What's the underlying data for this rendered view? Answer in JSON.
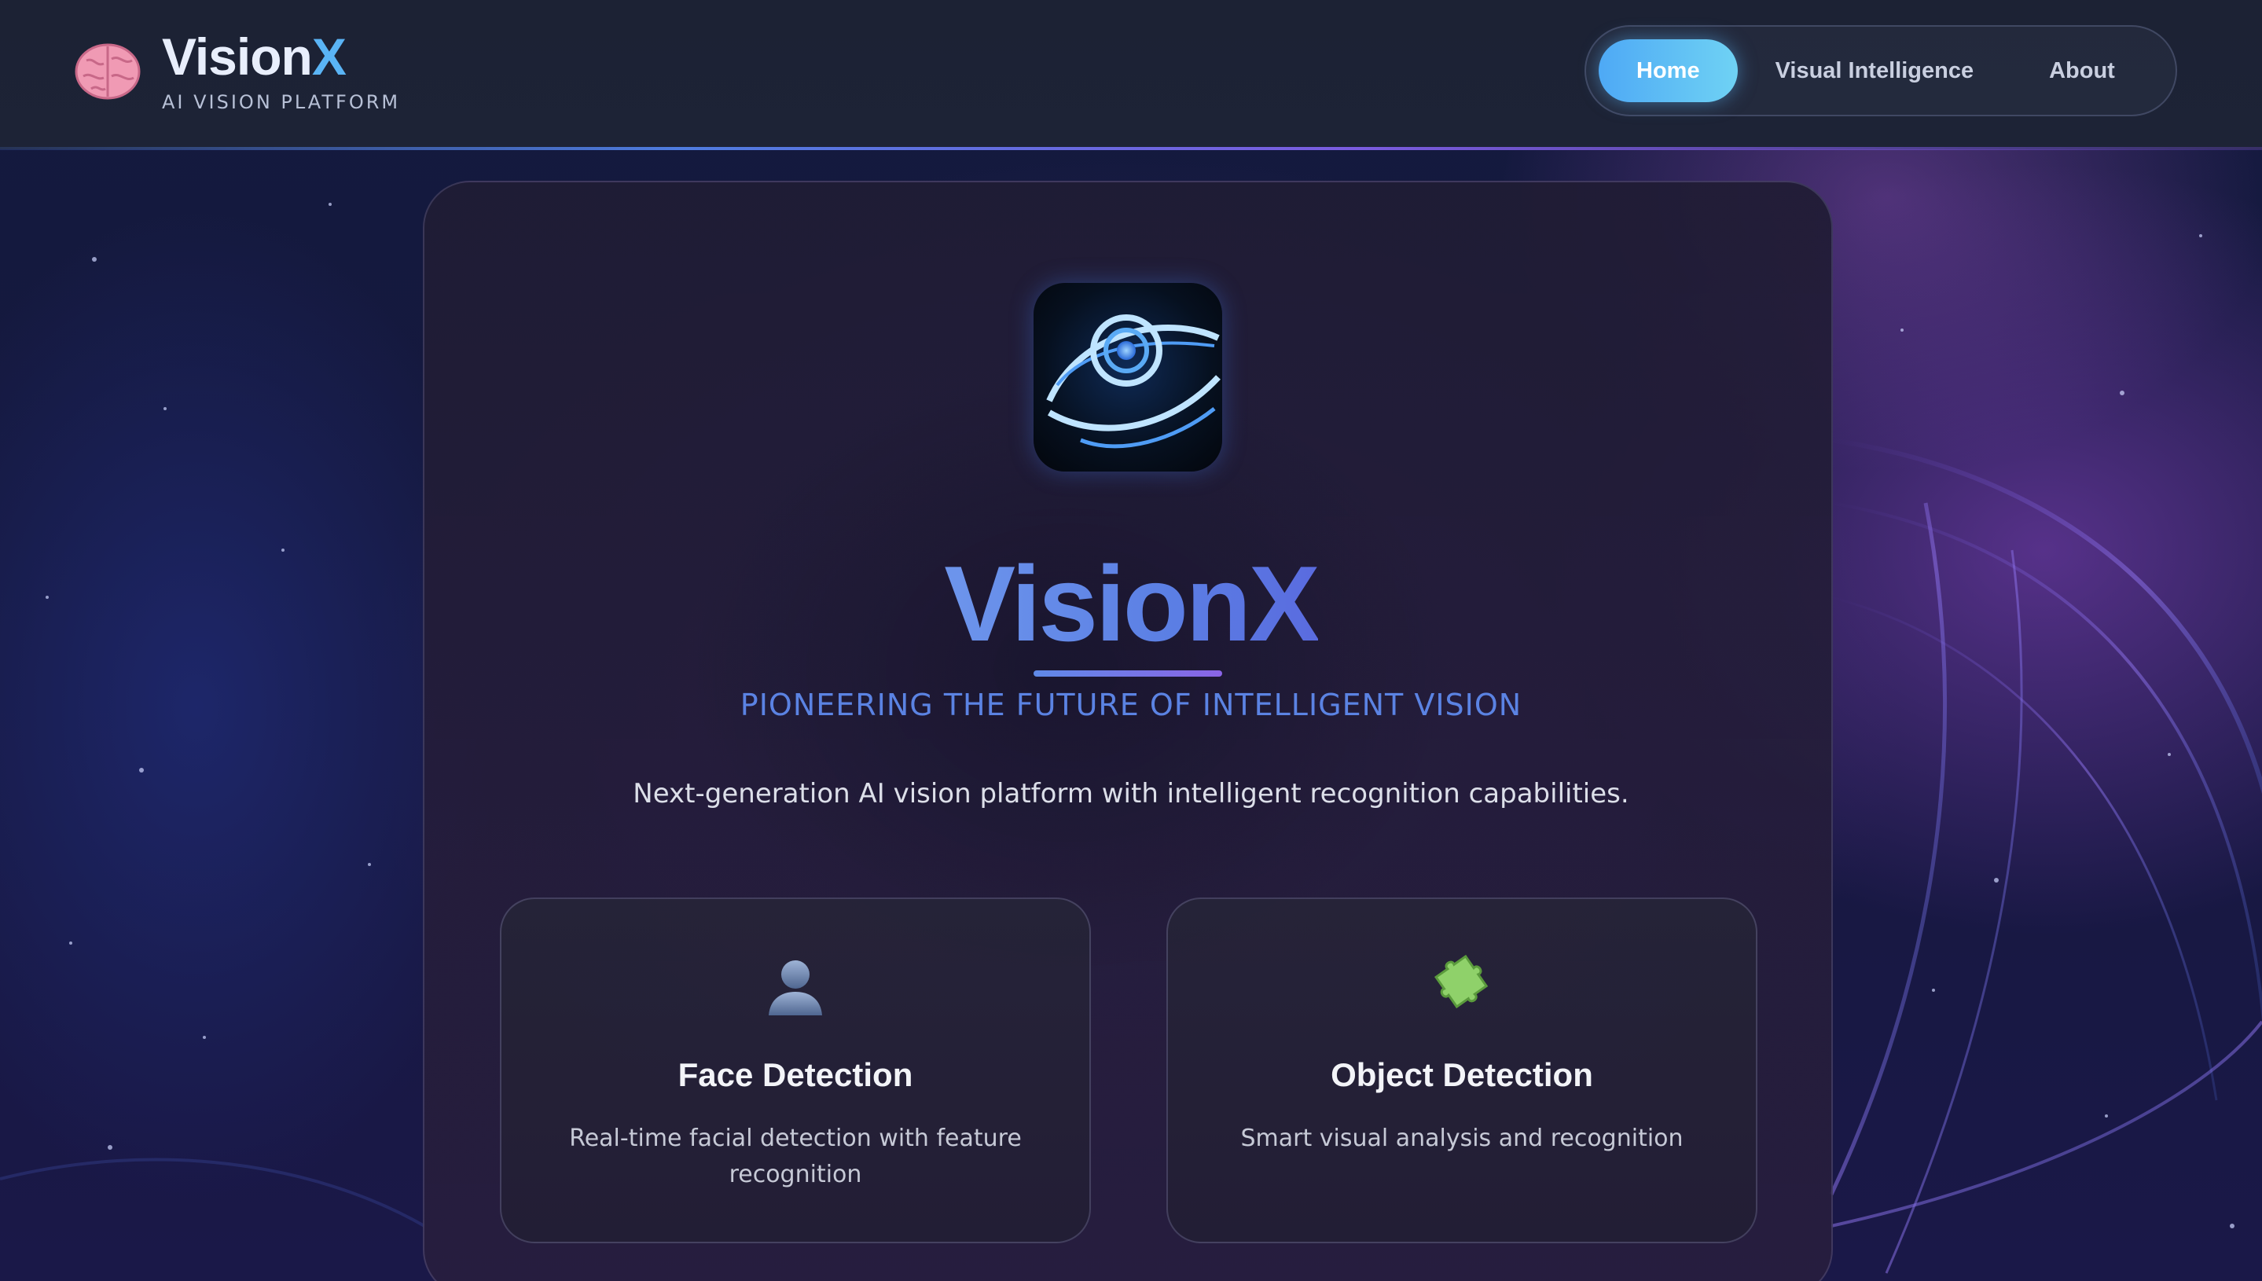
{
  "header": {
    "brand_title_main": "Vision",
    "brand_title_accent": "X",
    "brand_subtitle": "AI VISION PLATFORM",
    "brand_icon": "brain-icon"
  },
  "nav": {
    "items": [
      {
        "label": "Home",
        "active": true
      },
      {
        "label": "Visual Intelligence",
        "active": false
      },
      {
        "label": "About",
        "active": false
      }
    ]
  },
  "hero": {
    "logo_icon": "eye-icon",
    "title": "VisionX",
    "subtitle": "PIONEERING THE FUTURE OF INTELLIGENT VISION",
    "description": "Next-generation AI vision platform with intelligent recognition capabilities."
  },
  "features": [
    {
      "icon": "person-silhouette-icon",
      "title": "Face Detection",
      "description": "Real-time facial detection with feature recognition"
    },
    {
      "icon": "puzzle-piece-icon",
      "title": "Object Detection",
      "description": "Smart visual analysis and recognition"
    }
  ],
  "colors": {
    "accent_blue": "#5a86e6",
    "nav_active": "#4ea9f5",
    "brand_accent": "#5ab4f5"
  }
}
